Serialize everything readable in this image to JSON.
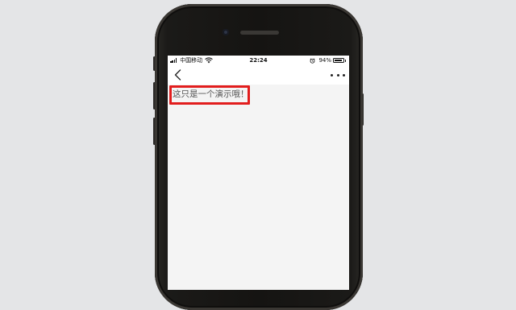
{
  "status_bar": {
    "carrier": "中国移动",
    "time": "22:24",
    "battery_percent": "94%",
    "battery_level": 0.94,
    "signal_icon": "signal-bars-icon",
    "wifi_icon": "wifi-icon",
    "alarm_icon": "alarm-icon"
  },
  "navbar": {
    "back_icon": "chevron-left-icon",
    "more_icon": "more-dots-icon"
  },
  "content": {
    "message": "这只是一个演示哦！"
  },
  "colors": {
    "background": "#e4e5e7",
    "screen": "#f4f4f4",
    "highlight": "#e21d1d",
    "text": "#555555"
  }
}
